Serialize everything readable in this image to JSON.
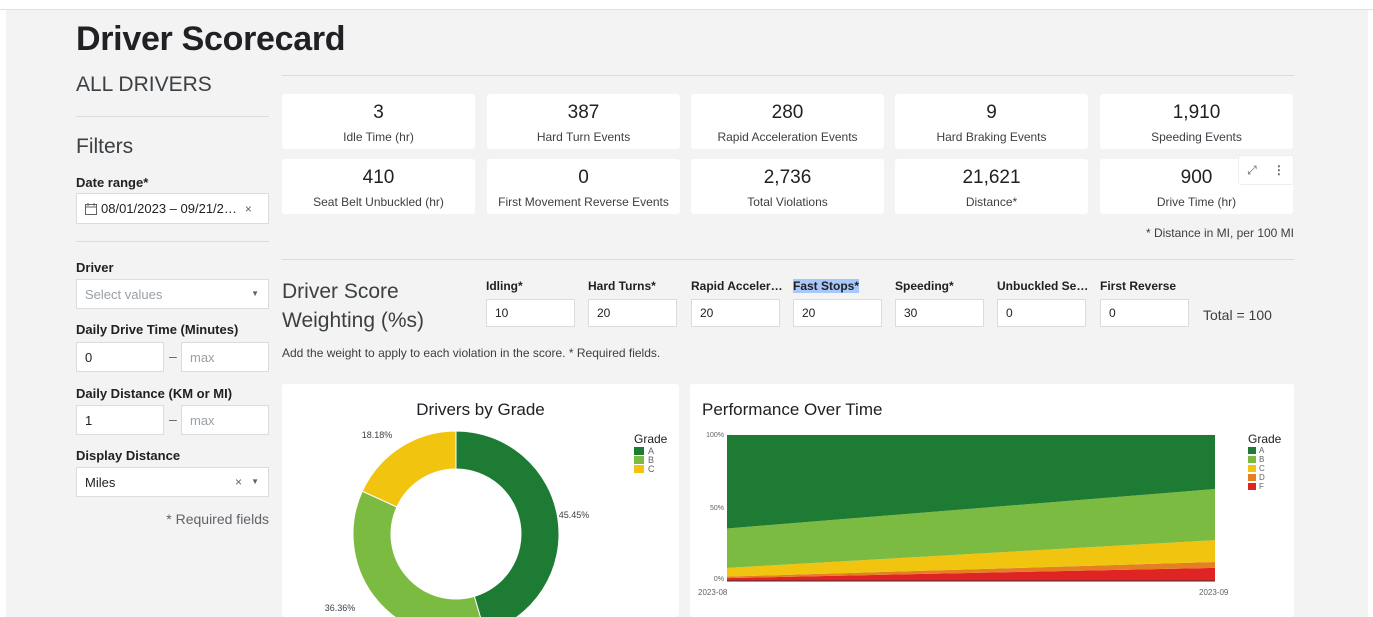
{
  "header": {
    "title": "Driver Scorecard",
    "subtitle": "ALL DRIVERS"
  },
  "filters": {
    "title": "Filters",
    "date_range": {
      "label": "Date range*",
      "value": "08/01/2023 – 09/21/2…"
    },
    "driver": {
      "label": "Driver",
      "placeholder": "Select values"
    },
    "daily_drive_time": {
      "label": "Daily Drive Time (Minutes)",
      "min": "0",
      "max_placeholder": "max"
    },
    "daily_distance": {
      "label": "Daily Distance (KM or MI)",
      "min": "1",
      "max_placeholder": "max"
    },
    "display_distance": {
      "label": "Display Distance",
      "value": "Miles"
    },
    "required_note": "* Required fields"
  },
  "kpis": [
    {
      "value": "3",
      "label": "Idle Time (hr)"
    },
    {
      "value": "387",
      "label": "Hard Turn Events"
    },
    {
      "value": "280",
      "label": "Rapid Acceleration Events"
    },
    {
      "value": "9",
      "label": "Hard Braking Events"
    },
    {
      "value": "1,910",
      "label": "Speeding Events"
    },
    {
      "value": "410",
      "label": "Seat Belt Unbuckled (hr)"
    },
    {
      "value": "0",
      "label": "First Movement Reverse Events"
    },
    {
      "value": "2,736",
      "label": "Total Violations"
    },
    {
      "value": "21,621",
      "label": "Distance*"
    },
    {
      "value": "900",
      "label": "Drive Time (hr)"
    }
  ],
  "distance_note": "* Distance in MI, per 100 MI",
  "weighting": {
    "title_line1": "Driver Score",
    "title_line2": "Weighting (%s)",
    "fields": [
      {
        "label": "Idling*",
        "value": "10"
      },
      {
        "label": "Hard Turns*",
        "value": "20"
      },
      {
        "label": "Rapid Acceler…",
        "value": "20"
      },
      {
        "label": "Fast Stops*",
        "value": "20"
      },
      {
        "label": "Speeding*",
        "value": "30"
      },
      {
        "label": "Unbuckled Se…",
        "value": "0"
      },
      {
        "label": "First Reverse",
        "value": "0"
      }
    ],
    "total": "Total = 100",
    "help": "Add the weight to apply to each violation in the score. * Required fields."
  },
  "colors": {
    "grade_a": "#1e7b34",
    "grade_b": "#7cbb42",
    "grade_c": "#f1c40f",
    "grade_d": "#e67e22",
    "grade_f": "#e02424"
  },
  "icons": {
    "calendar": "calendar-icon",
    "clear": "close-icon",
    "dropdown": "chevron-down-icon",
    "expand": "expand-icon",
    "more": "more-vert-icon"
  },
  "chart_data": [
    {
      "type": "pie",
      "title": "Drivers by Grade",
      "legend_title": "Grade",
      "legend_position": "right",
      "categories": [
        "A",
        "B",
        "C"
      ],
      "values": [
        45.45,
        36.36,
        18.18
      ],
      "labels": [
        "45.45%",
        "36.36%",
        "18.18%"
      ]
    },
    {
      "type": "area",
      "title": "Performance Over Time",
      "legend_title": "Grade",
      "legend_position": "right",
      "stacked_percent": true,
      "x": [
        "2023-08",
        "2023-09"
      ],
      "ytick_labels": [
        "0%",
        "50%",
        "100%"
      ],
      "series": [
        {
          "name": "A",
          "values": [
            64,
            37
          ]
        },
        {
          "name": "B",
          "values": [
            27,
            35
          ]
        },
        {
          "name": "C",
          "values": [
            6,
            15
          ]
        },
        {
          "name": "D",
          "values": [
            1,
            4
          ]
        },
        {
          "name": "F",
          "values": [
            2,
            9
          ]
        }
      ]
    }
  ]
}
